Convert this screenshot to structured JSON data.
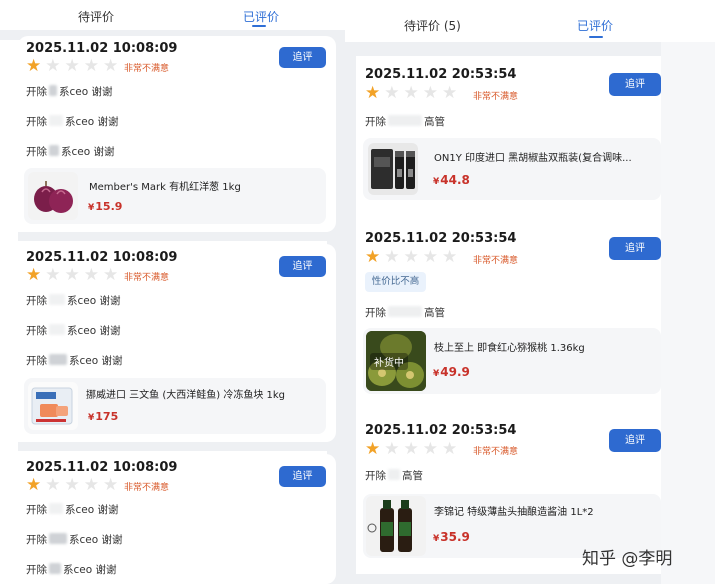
{
  "left": {
    "tabs": [
      {
        "label": "待评价",
        "active": false
      },
      {
        "label": "已评价",
        "active": true
      }
    ],
    "cards": [
      {
        "date": "2025.11.02 10:08:09",
        "stars_filled": 1,
        "stars_total": 5,
        "satisfaction": "非常不满意",
        "button": "追评",
        "lines": [
          {
            "prefix": "开除",
            "suffix": "系ceo 谢谢"
          },
          {
            "prefix": "开除",
            "suffix": "系ceo 谢谢"
          },
          {
            "prefix": "开除",
            "suffix": "系ceo 谢谢"
          }
        ],
        "product": {
          "name": "Member's Mark 有机红洋葱 1kg",
          "currency": "¥",
          "price": "15.9",
          "image": "red-onion"
        }
      },
      {
        "date": "2025.11.02 10:08:09",
        "stars_filled": 1,
        "stars_total": 5,
        "satisfaction": "非常不满意",
        "button": "追评",
        "lines": [
          {
            "prefix": "开除",
            "suffix": "系ceo 谢谢"
          },
          {
            "prefix": "开除",
            "suffix": "系ceo 谢谢"
          },
          {
            "prefix": "开除",
            "suffix": "系ceo 谢谢"
          }
        ],
        "product": {
          "name": "挪威进口 三文鱼 (大西洋鲑鱼) 冷冻鱼块 1kg",
          "currency": "¥",
          "price": "175",
          "image": "salmon-package"
        }
      },
      {
        "date": "2025.11.02 10:08:09",
        "stars_filled": 1,
        "stars_total": 5,
        "satisfaction": "非常不满意",
        "button": "追评",
        "lines": [
          {
            "prefix": "开除",
            "suffix": "系ceo 谢谢"
          },
          {
            "prefix": "开除",
            "suffix": "系ceo 谢谢"
          },
          {
            "prefix": "开除",
            "suffix": "系ceo 谢谢"
          }
        ]
      }
    ]
  },
  "right": {
    "tabs": [
      {
        "label": "待评价 (5)",
        "active": false
      },
      {
        "label": "已评价",
        "active": true
      }
    ],
    "cards": [
      {
        "date": "2025.11.02 20:53:54",
        "stars_filled": 1,
        "stars_total": 5,
        "satisfaction": "非常不满意",
        "button": "追评",
        "lines": [
          {
            "prefix": "开除",
            "suffix": "高管"
          }
        ],
        "product": {
          "name": "ON1Y 印度进口 黑胡椒盐双瓶装(复合调味...",
          "currency": "¥",
          "price": "44.8",
          "image": "pepper-bottles"
        }
      },
      {
        "date": "2025.11.02 20:53:54",
        "stars_filled": 1,
        "stars_total": 5,
        "satisfaction": "非常不满意",
        "button": "追评",
        "tag": "性价比不高",
        "lines": [
          {
            "prefix": "开除",
            "suffix": "高管"
          }
        ],
        "product": {
          "name": "枝上至上 即食红心猕猴桃 1.36kg",
          "currency": "¥",
          "price": "49.9",
          "image": "kiwi",
          "badge": "补货中"
        }
      },
      {
        "date": "2025.11.02 20:53:54",
        "stars_filled": 1,
        "stars_total": 5,
        "satisfaction": "非常不满意",
        "button": "追评",
        "lines": [
          {
            "prefix": "开除",
            "suffix": "高管"
          }
        ],
        "product": {
          "name": "李锦记 特级薄盐头抽酿造酱油 1L*2",
          "currency": "¥",
          "price": "35.9",
          "image": "soy-sauce-bottles"
        }
      }
    ]
  },
  "watermark": "知乎 @李明",
  "colors": {
    "accent": "#2e6ad0",
    "star": "#f2a227",
    "price": "#c8322a",
    "satisfaction": "#d85a2b"
  }
}
